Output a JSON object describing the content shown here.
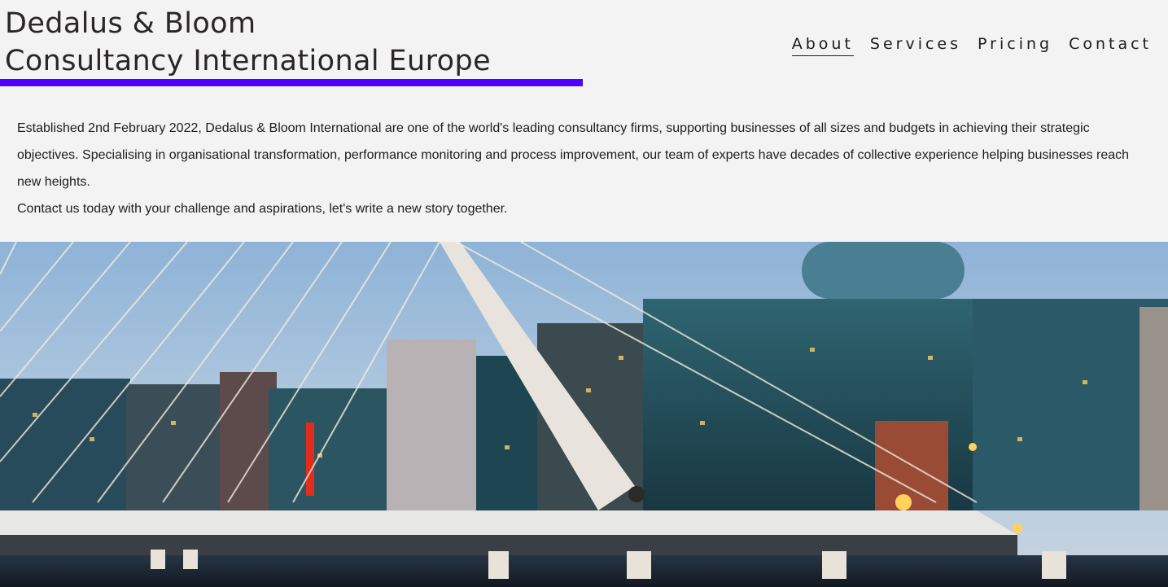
{
  "brand": {
    "line1": "Dedalus & Bloom",
    "line2": "Consultancy International Europe",
    "accent_color": "#4f00ff"
  },
  "nav": {
    "items": [
      {
        "label": "About",
        "active": true
      },
      {
        "label": "Services",
        "active": false
      },
      {
        "label": "Pricing",
        "active": false
      },
      {
        "label": "Contact",
        "active": false
      }
    ]
  },
  "intro": {
    "paragraph1": "Established 2nd February 2022, Dedalus & Bloom International are one of the world's leading consultancy firms, supporting businesses of all sizes and budgets in achieving their strategic objectives. Specialising in organisational transformation, performance monitoring and process improvement, our team of experts have decades of collective experience helping businesses reach new heights.",
    "paragraph2": "Contact us today with your challenge and aspirations, let's write a new story together."
  },
  "hero": {
    "image": "city-bridge-photo"
  }
}
